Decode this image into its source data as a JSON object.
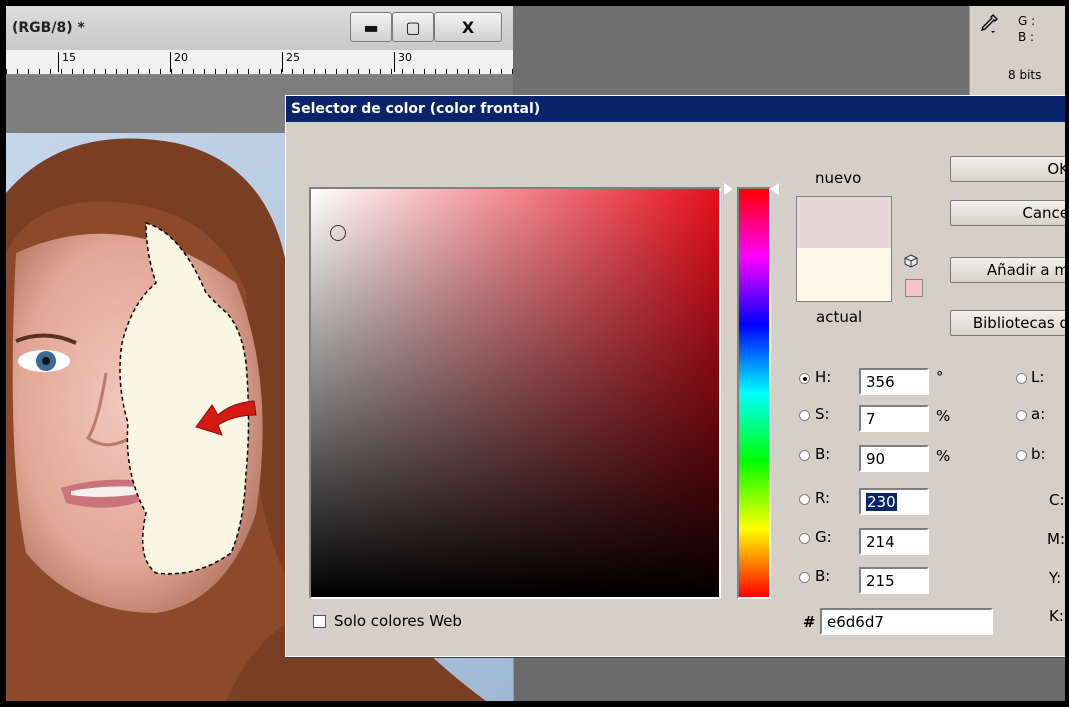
{
  "document_window": {
    "title": "(RGB/8) *",
    "buttons": {
      "minimize": "▬",
      "maximize": "▢",
      "close": "X"
    },
    "ruler_marks": [
      "15",
      "20",
      "25",
      "30"
    ]
  },
  "info_panel": {
    "g_label": "G :",
    "b_label": "B :",
    "bits": "8 bits"
  },
  "dialog": {
    "title": "Selector de color (color frontal)",
    "new_label": "nuevo",
    "current_label": "actual",
    "colors": {
      "new": "#e6d6d7",
      "current": "#fdf8ea"
    },
    "buttons": {
      "ok": "OK",
      "cancel": "Cance",
      "add_swatch": "Añadir a m",
      "libraries": "Bibliotecas d"
    },
    "fields": {
      "H": {
        "label": "H:",
        "value": "356",
        "unit": "°",
        "selected": true
      },
      "S": {
        "label": "S:",
        "value": "7",
        "unit": "%"
      },
      "B": {
        "label": "B:",
        "value": "90",
        "unit": "%"
      },
      "R": {
        "label": "R:",
        "value": "230"
      },
      "G": {
        "label": "G:",
        "value": "214"
      },
      "Bl": {
        "label": "B:",
        "value": "215"
      },
      "L": {
        "label": "L:"
      },
      "a": {
        "label": "a:"
      },
      "b": {
        "label": "b:"
      },
      "C": {
        "label": "C:"
      },
      "M": {
        "label": "M:"
      },
      "Y": {
        "label": "Y:"
      },
      "K": {
        "label": "K:"
      }
    },
    "hex_label": "#",
    "hex_value": "e6d6d7",
    "web_only_label": "Solo colores Web"
  }
}
